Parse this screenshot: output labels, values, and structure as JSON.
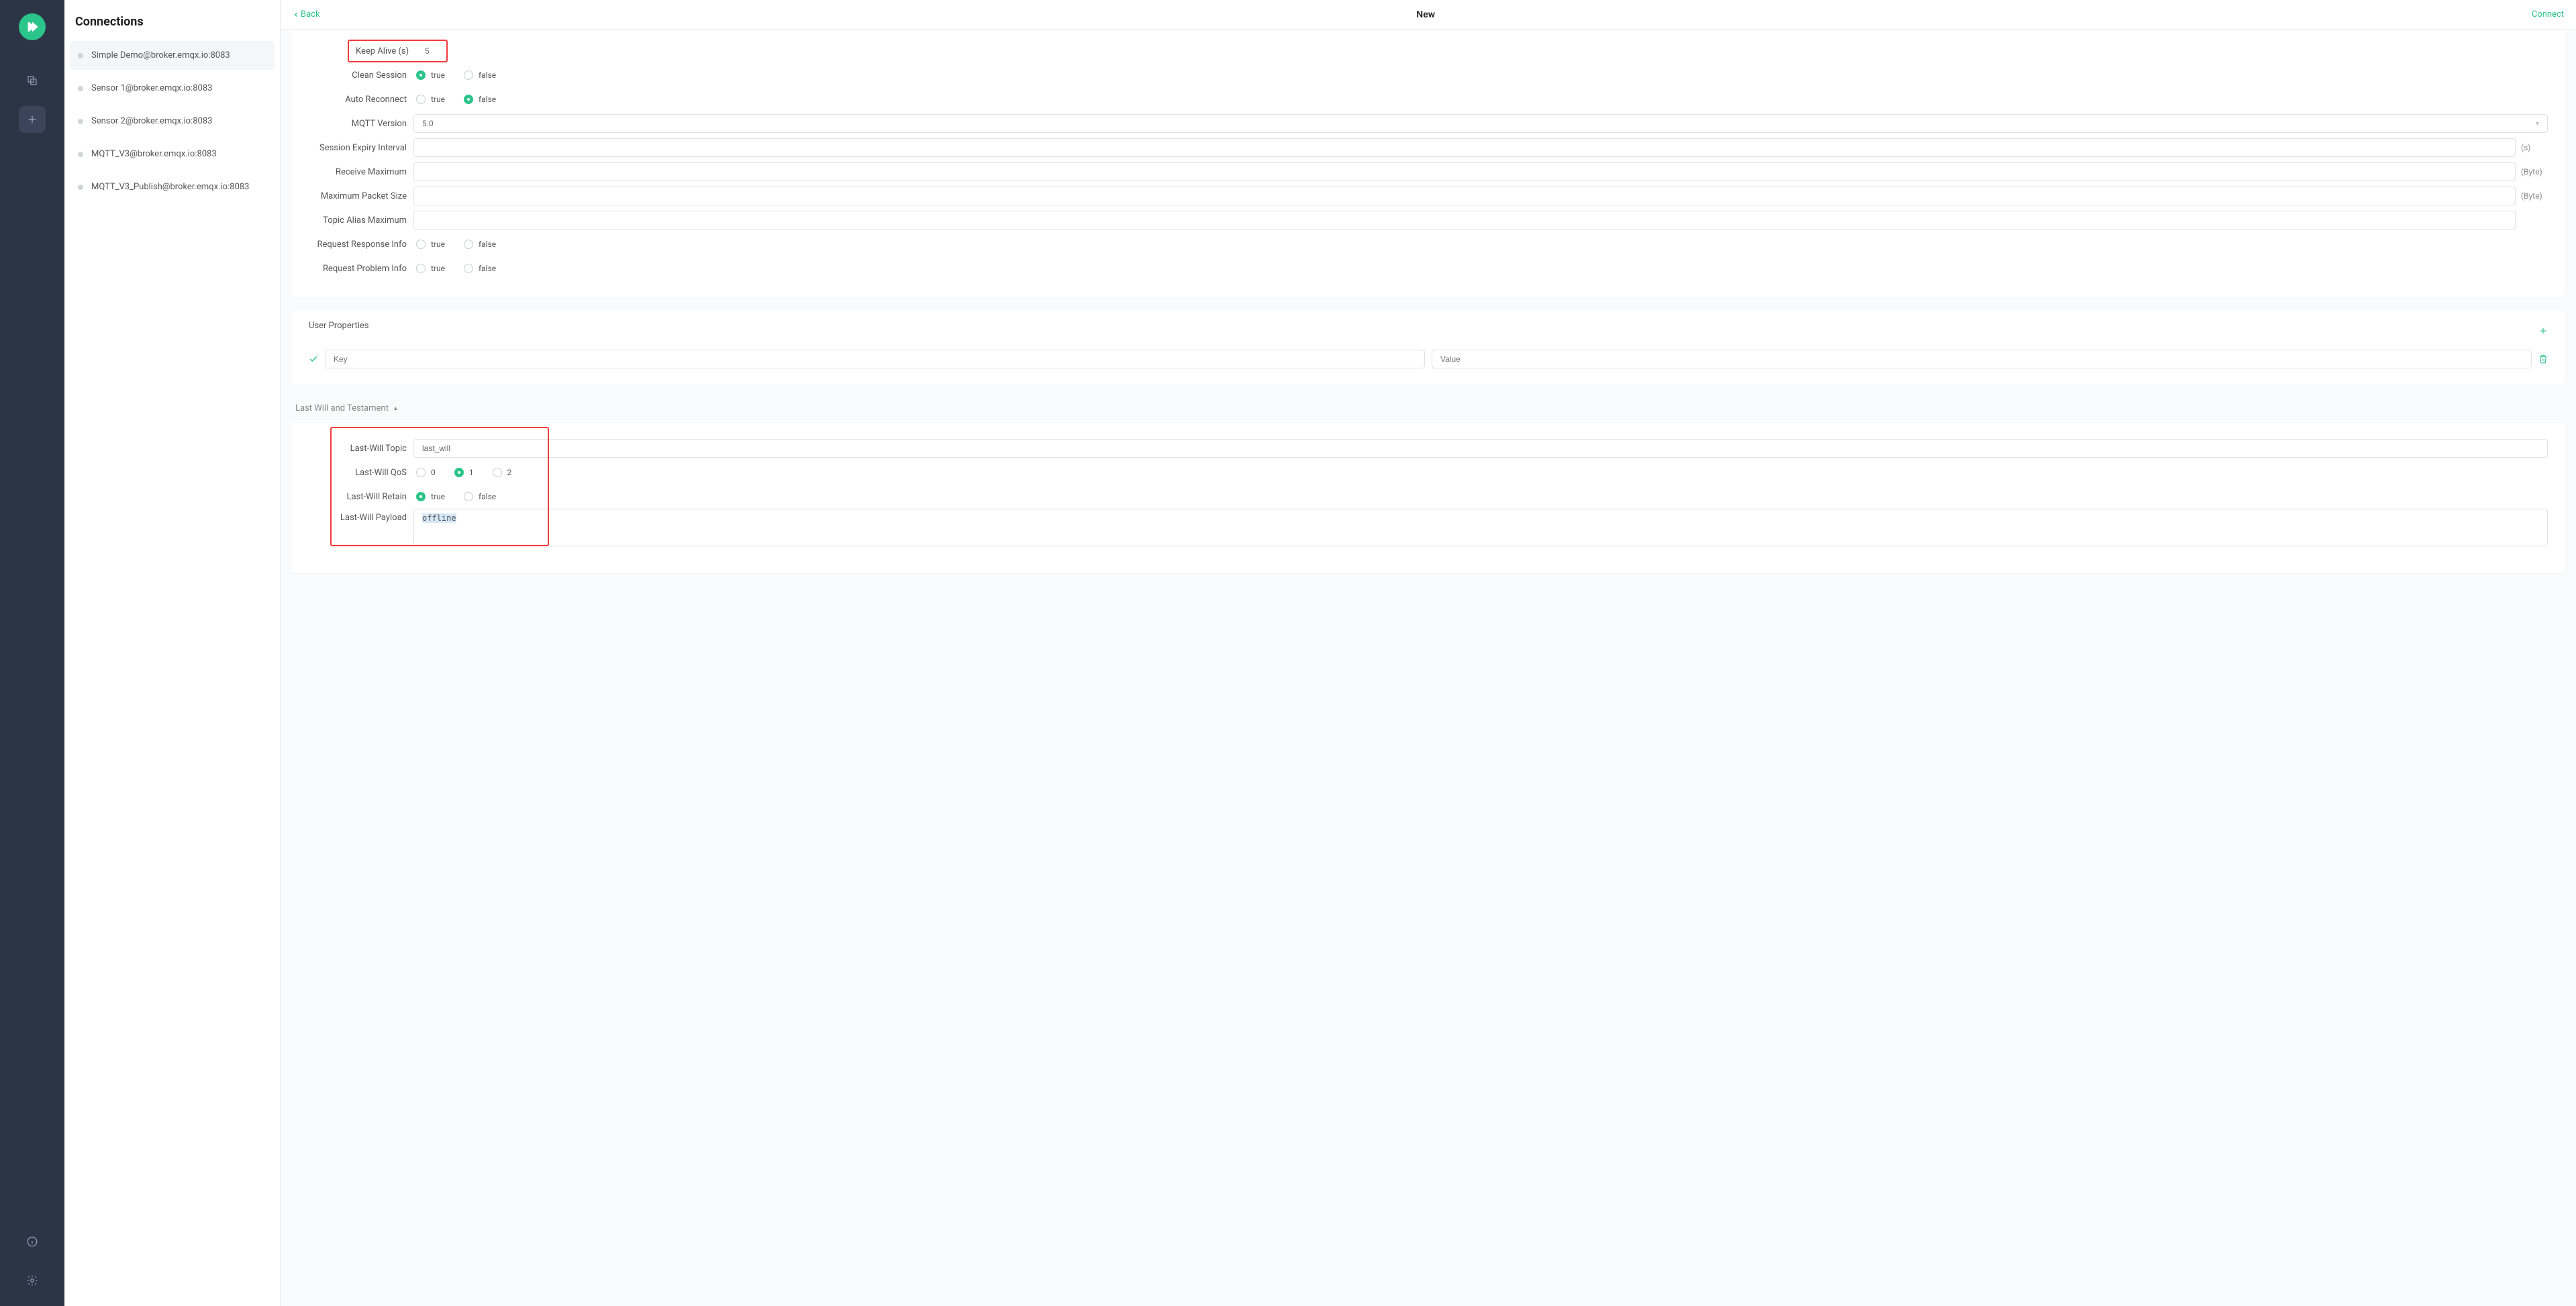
{
  "sidebar": {
    "title": "Connections",
    "items": [
      {
        "label": "Simple Demo@broker.emqx.io:8083",
        "active": true
      },
      {
        "label": "Sensor 1@broker.emqx.io:8083",
        "active": false
      },
      {
        "label": "Sensor 2@broker.emqx.io:8083",
        "active": false
      },
      {
        "label": "MQTT_V3@broker.emqx.io:8083",
        "active": false
      },
      {
        "label": "MQTT_V3_Publish@broker.emqx.io:8083",
        "active": false
      }
    ]
  },
  "topbar": {
    "back": "Back",
    "title": "New",
    "connect": "Connect"
  },
  "form": {
    "keep_alive_label": "Keep Alive (s)",
    "keep_alive_value": "5",
    "clean_session_label": "Clean Session",
    "auto_reconnect_label": "Auto Reconnect",
    "mqtt_version_label": "MQTT Version",
    "mqtt_version_value": "5.0",
    "session_expiry_label": "Session Expiry Interval",
    "session_expiry_suffix": "(s)",
    "receive_max_label": "Receive Maximum",
    "receive_max_suffix": "(Byte)",
    "max_packet_label": "Maximum Packet Size",
    "max_packet_suffix": "(Byte)",
    "topic_alias_label": "Topic Alias Maximum",
    "req_response_label": "Request Response Info",
    "req_problem_label": "Request Problem Info",
    "true": "true",
    "false": "false"
  },
  "user_props": {
    "title": "User Properties",
    "key_placeholder": "Key",
    "value_placeholder": "Value"
  },
  "lwt": {
    "section_title": "Last Will and Testament",
    "topic_label": "Last-Will Topic",
    "topic_value": "last_will",
    "qos_label": "Last-Will QoS",
    "qos_0": "0",
    "qos_1": "1",
    "qos_2": "2",
    "retain_label": "Last-Will Retain",
    "payload_label": "Last-Will Payload",
    "payload_value": "offline"
  }
}
